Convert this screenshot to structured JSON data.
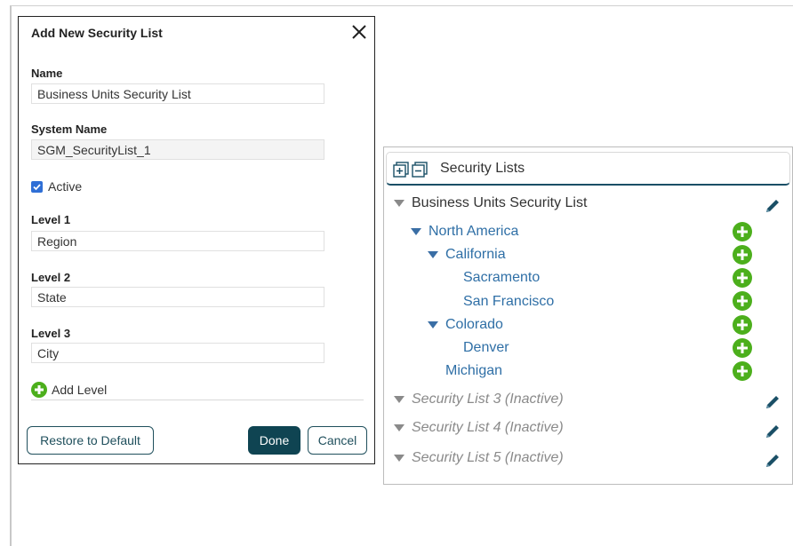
{
  "dialog": {
    "title": "Add New Security List",
    "name_label": "Name",
    "name_value": "Business Units Security List",
    "system_name_label": "System Name",
    "system_name_value": "SGM_SecurityList_1",
    "active_label": "Active",
    "active_checked": true,
    "levels": [
      {
        "label": "Level 1",
        "value": "Region"
      },
      {
        "label": "Level 2",
        "value": "State"
      },
      {
        "label": "Level 3",
        "value": "City"
      }
    ],
    "add_level_label": "Add Level",
    "restore_label": "Restore to Default",
    "done_label": "Done",
    "cancel_label": "Cancel"
  },
  "panel": {
    "title": "Security Lists",
    "tree": [
      {
        "label": "Business Units Security List",
        "action": "edit"
      },
      {
        "label": "North America",
        "action": "add"
      },
      {
        "label": "California",
        "action": "add"
      },
      {
        "label": "Sacramento",
        "action": "add"
      },
      {
        "label": "San Francisco",
        "action": "add"
      },
      {
        "label": "Colorado",
        "action": "add"
      },
      {
        "label": "Denver",
        "action": "add"
      },
      {
        "label": "Michigan",
        "action": "add"
      },
      {
        "label": "Security List 3 (Inactive)",
        "action": "edit"
      },
      {
        "label": "Security List 4 (Inactive)",
        "action": "edit"
      },
      {
        "label": "Security List 5 (Inactive)",
        "action": "edit"
      }
    ]
  },
  "colors": {
    "primary": "#0f4452",
    "tree_link": "#2f6fa6",
    "add_green": "#4caf1c",
    "pencil_blue": "#1a4f66",
    "inactive": "#8a8a8a"
  }
}
